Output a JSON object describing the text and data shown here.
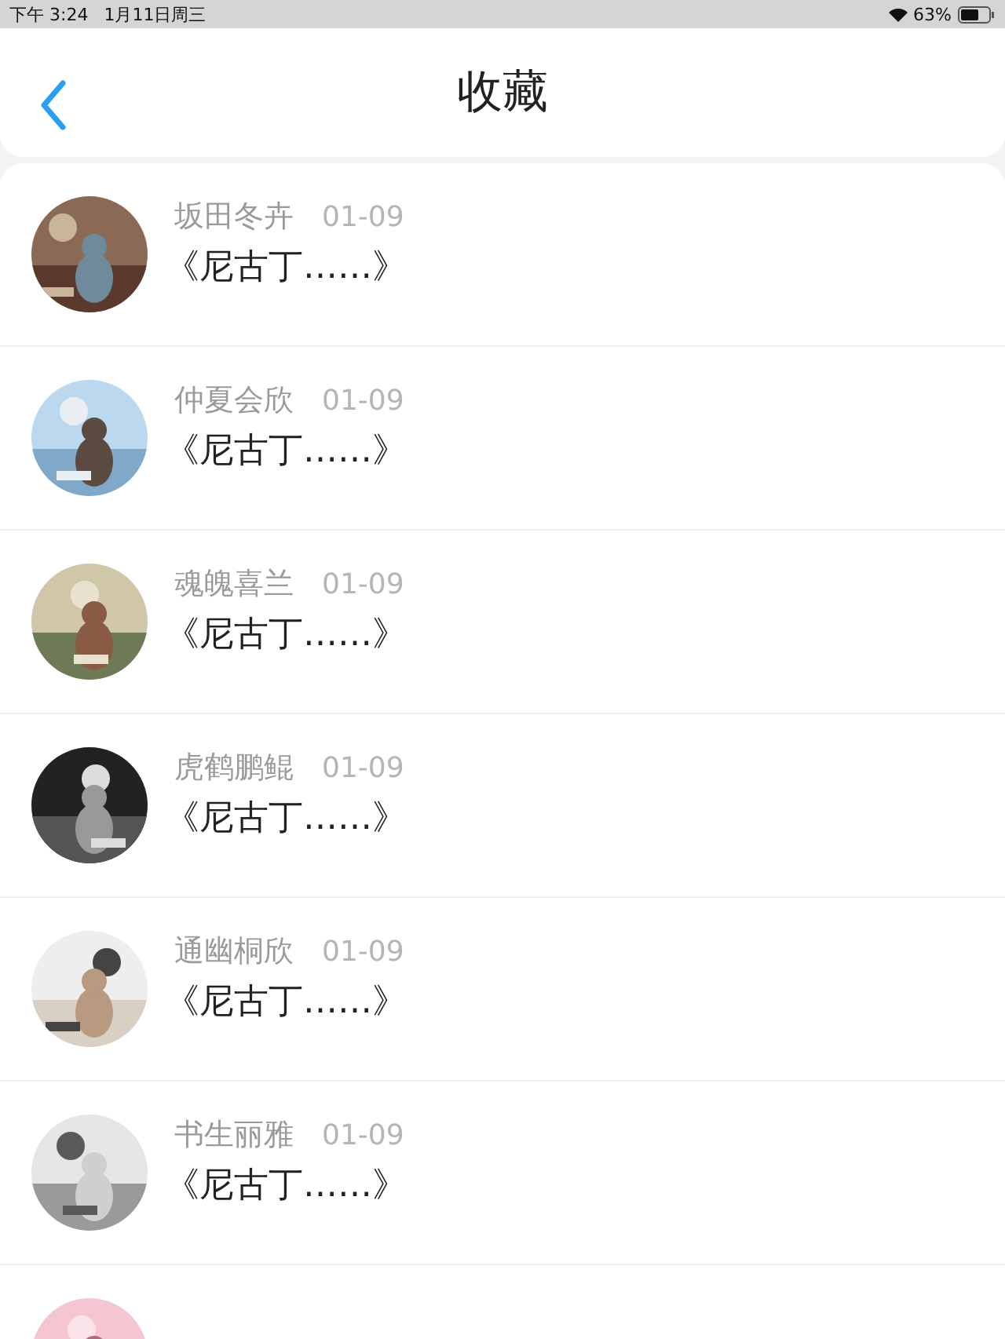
{
  "status_bar": {
    "time": "下午 3:24",
    "date": "1月11日周三",
    "battery": "63%"
  },
  "header": {
    "title": "收藏"
  },
  "items": [
    {
      "kind": "entry",
      "name": "坂田冬卉",
      "date": "01-09",
      "title": "《尼古丁……》"
    },
    {
      "kind": "entry",
      "name": "仲夏会欣",
      "date": "01-09",
      "title": "《尼古丁……》"
    },
    {
      "kind": "entry",
      "name": "魂魄喜兰",
      "date": "01-09",
      "title": "《尼古丁……》"
    },
    {
      "kind": "entry",
      "name": "虎鹤鹏鲲",
      "date": "01-09",
      "title": "《尼古丁……》"
    },
    {
      "kind": "entry",
      "name": "通幽桐欣",
      "date": "01-09",
      "title": "《尼古丁……》"
    },
    {
      "kind": "entry",
      "name": "书生丽雅",
      "date": "01-09",
      "title": "《尼古丁……》"
    },
    {
      "kind": "picture"
    }
  ]
}
